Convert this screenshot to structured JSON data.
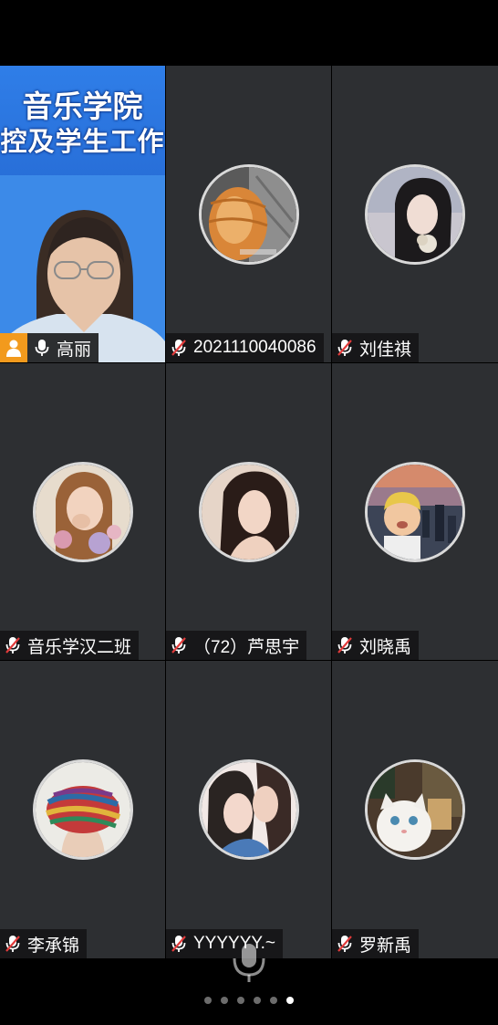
{
  "meeting": {
    "slide_line1": "音乐学院",
    "slide_line2": "控及学生工作",
    "participants": [
      {
        "name": "高丽",
        "mic": "on",
        "role": "host",
        "video": true
      },
      {
        "name": "2021110040086",
        "mic": "muted",
        "video": false
      },
      {
        "name": "刘佳祺",
        "mic": "muted",
        "video": false
      },
      {
        "name": "音乐学汉二班",
        "mic": "muted",
        "video": false
      },
      {
        "name": "（72）芦思宇",
        "mic": "muted",
        "video": false
      },
      {
        "name": "刘晓禹",
        "mic": "muted",
        "video": false
      },
      {
        "name": "李承锦",
        "mic": "muted",
        "video": false
      },
      {
        "name": "YYYYYY.~",
        "mic": "muted",
        "video": false
      },
      {
        "name": "罗新禹",
        "mic": "muted",
        "video": false
      }
    ]
  },
  "pager": {
    "total": 6,
    "current": 6
  },
  "colors": {
    "tile_bg": "#2d2f32",
    "host_badge": "#f29a1d",
    "muted_red": "#e23b3b"
  }
}
